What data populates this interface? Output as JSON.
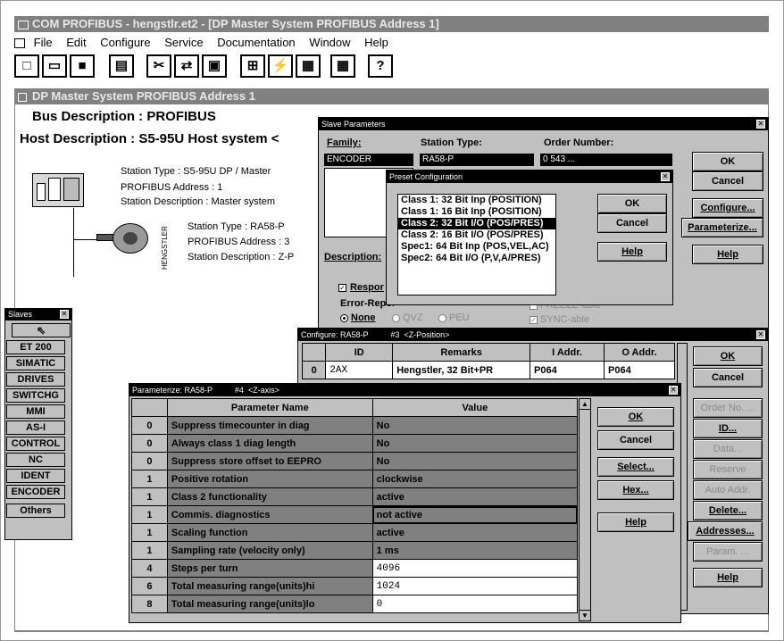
{
  "app": {
    "title": "COM PROFIBUS - hengstlr.et2 - [DP Master System PROFIBUS Address  1]"
  },
  "menu": [
    "File",
    "Edit",
    "Configure",
    "Service",
    "Documentation",
    "Window",
    "Help"
  ],
  "toolbar": {
    "help_label": "?"
  },
  "child_window": {
    "title": "DP Master System PROFIBUS Address  1"
  },
  "bus": {
    "description": "Bus Description : PROFIBUS",
    "host": "Host Description : S5-95U  Host system <"
  },
  "master": {
    "station_type": "Station Type : S5-95U DP / Master",
    "address": "PROFIBUS Address : 1",
    "station_desc": "Station Description : Master system"
  },
  "encoder": {
    "station_type": "Station Type : RA58-P",
    "address": "PROFIBUS Address : 3",
    "station_desc": "Station Description : Z-P",
    "brand": "HENGSTLER"
  },
  "slaves": {
    "title": "Slaves",
    "items": [
      "ET 200",
      "SIMATIC",
      "DRIVES",
      "SWITCHG",
      "MMI",
      "AS-I",
      "CONTROL",
      "NC",
      "IDENT",
      "ENCODER",
      "Others"
    ]
  },
  "slave_params": {
    "title": "Slave Parameters",
    "family_label": "Family:",
    "family_value": "ENCODER",
    "station_type_label": "Station Type:",
    "station_type_value": "RA58-P",
    "order_label": "Order Number:",
    "order_value": "0 543 ...",
    "description_label": "Description:",
    "response_label": "Respor",
    "error_label": "Error-Reporting:",
    "radio_none": "None",
    "radio_qvz": "QVZ",
    "radio_peu": "PEU",
    "freeze": "FREEZE-able",
    "sync": "SYNC-able",
    "buttons": {
      "ok": "OK",
      "cancel": "Cancel",
      "configure": "Configure...",
      "parameterize": "Parameterize...",
      "help": "Help"
    }
  },
  "preset": {
    "title": "Preset Configuration",
    "items": [
      "Class 1: 32 Bit Inp (POSITION)",
      "Class 1: 16 Bit Inp (POSITION)",
      "Class 2: 32 Bit I/O (POS/PRES)",
      "Class 2: 16 Bit I/O (POS/PRES)",
      "Spec1: 64 Bit Inp (POS,VEL,AC)",
      "Spec2: 64 Bit I/O (P,V,A/PRES)"
    ],
    "selected": 2,
    "buttons": {
      "ok": "OK",
      "cancel": "Cancel",
      "help": "Help"
    }
  },
  "configure": {
    "title": "Configure: RA58-P          #3  <Z-Position>",
    "headers": [
      "ID",
      "Remarks",
      "I Addr.",
      "O Addr."
    ],
    "rows": [
      [
        "0",
        "2AX",
        "Hengstler, 32 Bit+PR",
        "P064",
        "P064"
      ]
    ],
    "buttons": {
      "ok": "OK",
      "cancel": "Cancel",
      "order_no": "Order No. ...",
      "id": "ID...",
      "data": "Data...",
      "reserve": "Reserve",
      "auto_addr": "Auto Addr.",
      "delete": "Delete...",
      "addresses": "Addresses...",
      "param": "Param. ...",
      "help": "Help"
    }
  },
  "parameterize": {
    "title": "Parameterize: RA58-P          #4  <Z-axis>",
    "headers": [
      "Parameter Name",
      "Value"
    ],
    "rows": [
      {
        "n": "0",
        "name": "Suppress timecounter in diag",
        "value": "No"
      },
      {
        "n": "0",
        "name": "Always class 1 diag length",
        "value": "No"
      },
      {
        "n": "0",
        "name": "Suppress store offset to EEPRO",
        "value": "No"
      },
      {
        "n": "1",
        "name": "Positive rotation",
        "value": "clockwise"
      },
      {
        "n": "1",
        "name": "Class 2 functionality",
        "value": "active"
      },
      {
        "n": "1",
        "name": "Commis. diagnostics",
        "value": "not active"
      },
      {
        "n": "1",
        "name": "Scaling function",
        "value": "active"
      },
      {
        "n": "1",
        "name": "Sampling rate (velocity only)",
        "value": "1 ms"
      },
      {
        "n": "4",
        "name": "Steps per turn",
        "value": "4096"
      },
      {
        "n": "6",
        "name": "Total measuring range(units)hi",
        "value": "1024"
      },
      {
        "n": "8",
        "name": "Total measuring range(units)lo",
        "value": "0"
      }
    ],
    "buttons": {
      "ok": "OK",
      "cancel": "Cancel",
      "select": "Select...",
      "hex": "Hex...",
      "help": "Help"
    }
  }
}
